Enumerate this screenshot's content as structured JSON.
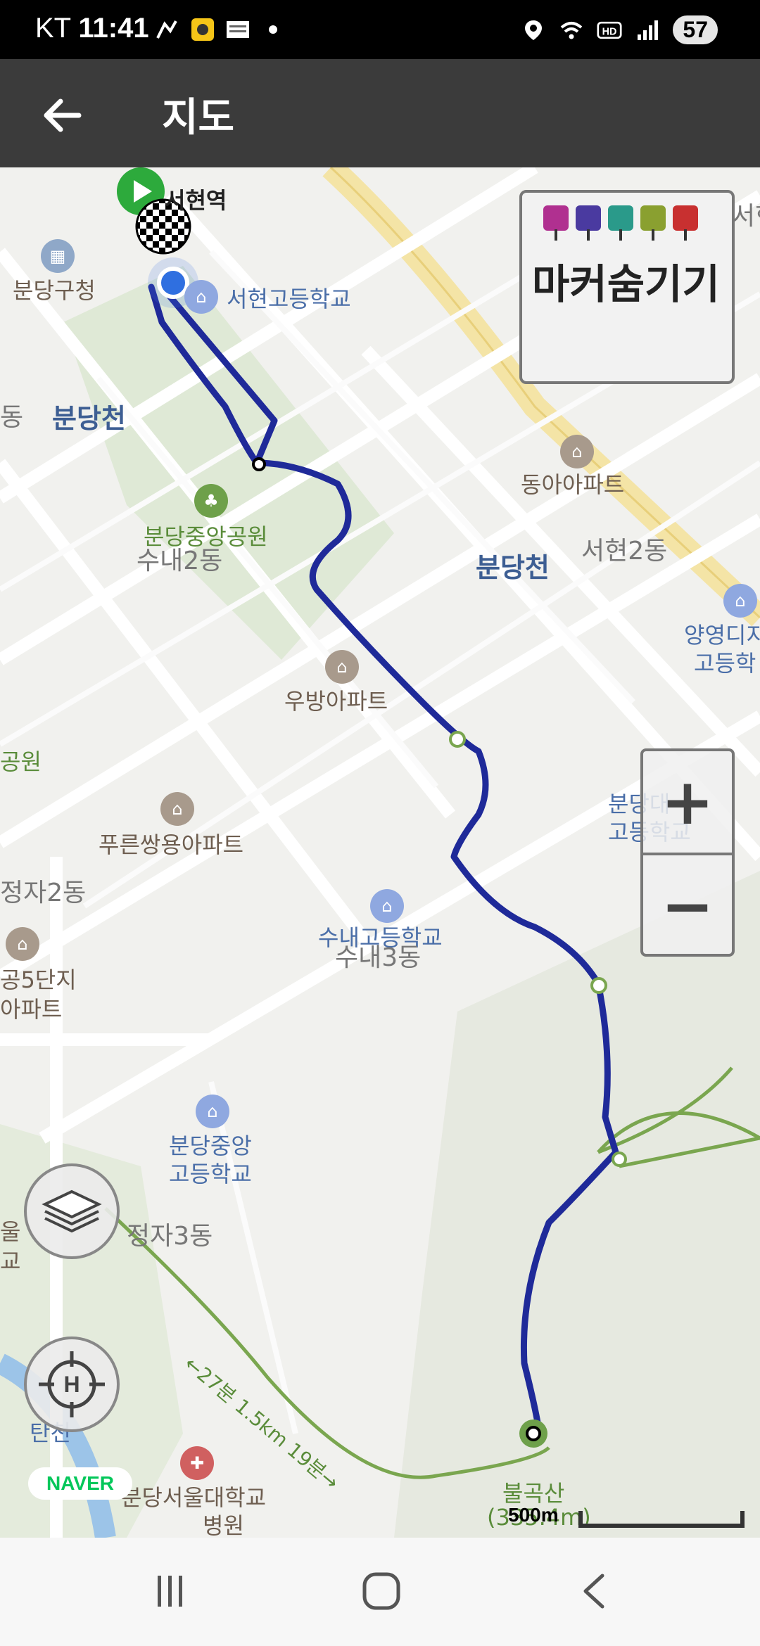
{
  "status_bar": {
    "carrier": "KT",
    "time": "11:41",
    "battery": "57"
  },
  "app_bar": {
    "title": "지도"
  },
  "map": {
    "labels": {
      "seohyeon_station": "서현역",
      "bundang_gu_office": "분당구청",
      "seohyeon_high": "서현고등학교",
      "bundangcheon_left": "분당천",
      "dong_left": "동",
      "donga_apt": "동아아파트",
      "bundang_central_park": "분당중앙공원",
      "sunae_2dong": "수내2동",
      "bundangcheon_right": "분당천",
      "seohyeon_2dong": "서현2동",
      "yangyoung_high_1": "양영디지",
      "yangyoung_high_2": "고등학",
      "ubang_apt": "우방아파트",
      "park_left": "공원",
      "bundang_high_1": "분당대",
      "bundang_high_2": "고등학교",
      "pureun_ssangyong_apt": "푸른쌍용아파트",
      "jeongja_2dong": "정자2동",
      "sunae_high": "수내고등학교",
      "sunae_3dong": "수내3동",
      "complex_5_1": "공5단지",
      "complex_5_2": "아파트",
      "bundang_jungang_high_1": "분당중앙",
      "bundang_jungang_high_2": "고등학교",
      "jeongja_3dong": "정자3동",
      "trail_info": "←27분 1.5km 19분→",
      "tancheon": "탄천",
      "snu_hospital_1": "분당서울대학교",
      "snu_hospital_2": "병원",
      "bulgoksan": "불곡산",
      "bulgoksan_elev": "(335.4m)",
      "side_left_1": "울",
      "side_left_2": "교",
      "seohyeon_right": "서현수"
    },
    "marker_panel": {
      "label": "마커숨기기",
      "pin_colors": [
        "#b03090",
        "#4a3aa0",
        "#2a9a8a",
        "#8aa030",
        "#c83030"
      ]
    },
    "zoom": {
      "plus": "+",
      "minus": "−"
    },
    "naver_logo": "NAVER",
    "scale_label": "500m",
    "route_color": "#1f2a99",
    "icons": [
      "layers-icon",
      "location-target-icon",
      "start-flag-icon",
      "finish-flag-icon",
      "current-location-icon"
    ]
  },
  "nav_bar": {
    "buttons": [
      "recent-apps",
      "home",
      "back"
    ]
  }
}
